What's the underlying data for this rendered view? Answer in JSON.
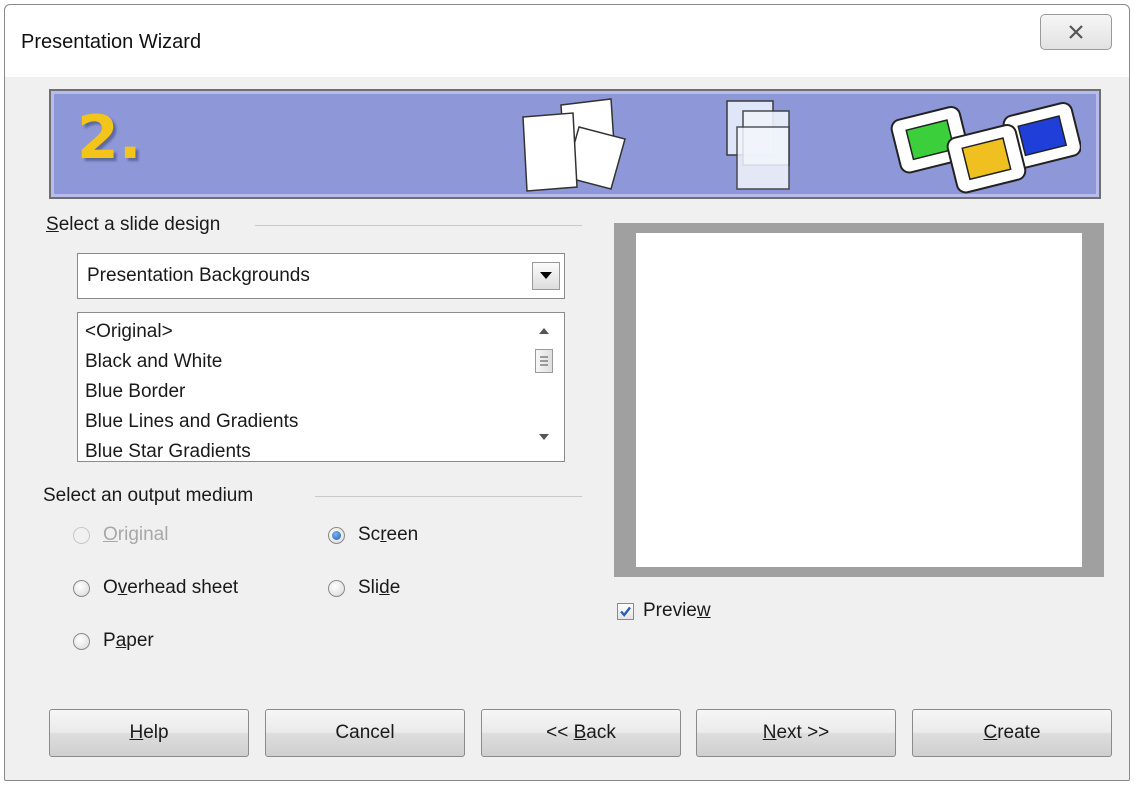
{
  "window": {
    "title": "Presentation Wizard"
  },
  "banner": {
    "step_label": "2."
  },
  "slide_design": {
    "group_label_mnemonic": "S",
    "group_label_rest": "elect a slide design",
    "category_selected": "Presentation Backgrounds",
    "designs": [
      "<Original>",
      "Black and White",
      "Blue Border",
      "Blue Lines and Gradients",
      "Blue Star Gradients"
    ]
  },
  "output_medium": {
    "group_label": "Select an output medium",
    "options": [
      {
        "pre": "",
        "mn": "O",
        "post": "riginal",
        "selected": false,
        "enabled": false
      },
      {
        "pre": "O",
        "mn": "v",
        "post": "erhead sheet",
        "selected": false,
        "enabled": true
      },
      {
        "pre": "P",
        "mn": "a",
        "post": "per",
        "selected": false,
        "enabled": true
      },
      {
        "pre": "Sc",
        "mn": "r",
        "post": "een",
        "selected": true,
        "enabled": true
      },
      {
        "pre": "Sli",
        "mn": "d",
        "post": "e",
        "selected": false,
        "enabled": true
      }
    ]
  },
  "preview": {
    "checkbox_pre": "Previe",
    "checkbox_mn": "w",
    "checked": true
  },
  "buttons": {
    "help": {
      "pre": "",
      "mn": "H",
      "post": "elp"
    },
    "cancel": {
      "pre": "Cancel",
      "mn": "",
      "post": ""
    },
    "back": {
      "pre": "<< ",
      "mn": "B",
      "post": "ack"
    },
    "next": {
      "pre": "",
      "mn": "N",
      "post": "ext >>"
    },
    "create": {
      "pre": "",
      "mn": "C",
      "post": "reate"
    }
  },
  "colors": {
    "banner": "#8e97d8",
    "step_number": "#f3c51b",
    "radio_selected": "#1b5fb0",
    "checkmark": "#2b5fb4"
  }
}
